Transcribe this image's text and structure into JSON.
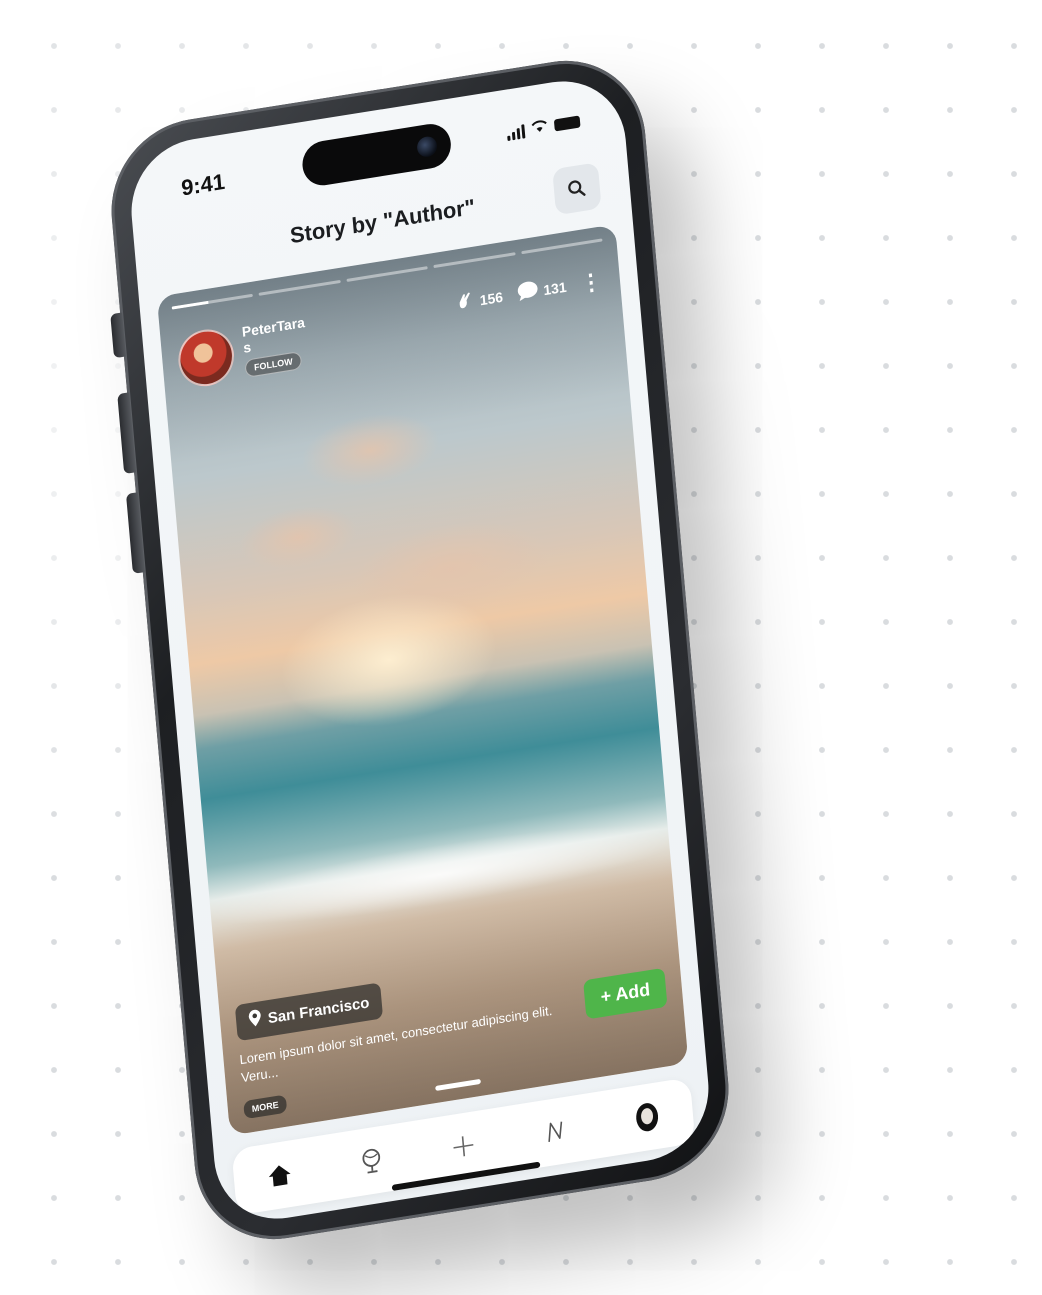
{
  "status_bar": {
    "time": "9:41"
  },
  "header": {
    "title": "Story by \"Author\"",
    "search_icon": "search-icon"
  },
  "story": {
    "progress": {
      "segments": 5,
      "active_index": 0,
      "active_fill": 0.45
    },
    "author": {
      "name": "PeterTaras",
      "follow_label": "FOLLOW"
    },
    "stats": {
      "claps": "156",
      "comments": "131"
    },
    "location": "San Francisco",
    "caption": "Lorem ipsum dolor sit amet, consectetur adipiscing elit. Veru...",
    "more_label": "MORE",
    "add_label": "+ Add"
  },
  "tabbar": {
    "items": [
      {
        "icon": "home-icon",
        "active": true
      },
      {
        "icon": "globe-icon",
        "active": false
      },
      {
        "icon": "plus-icon",
        "active": false
      },
      {
        "icon": "n-icon",
        "active": false
      },
      {
        "icon": "profile-avatar",
        "active": false
      }
    ]
  },
  "colors": {
    "add_button": "#4fb54a",
    "phone_frame": "#2b2d31",
    "screen_bg": "#f4f7f9"
  }
}
